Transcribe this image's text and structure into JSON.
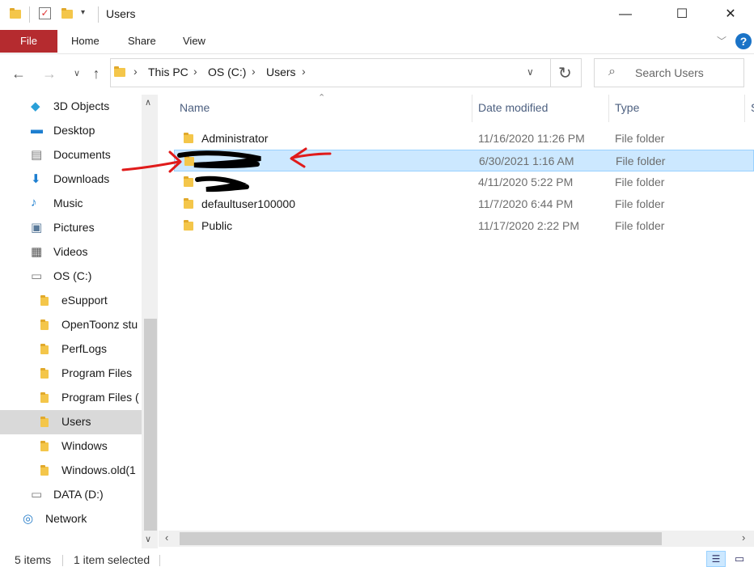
{
  "window": {
    "title": "Users",
    "controls": [
      "—",
      "☐",
      "✕"
    ]
  },
  "ribbon": {
    "file_label": "File",
    "tabs": [
      "Home",
      "Share",
      "View"
    ]
  },
  "address": {
    "crumbs": [
      "This PC",
      "OS (C:)",
      "Users"
    ],
    "search_placeholder": "Search Users"
  },
  "nav": {
    "items": [
      {
        "label": "3D Objects",
        "icon": "3d-objects-icon"
      },
      {
        "label": "Desktop",
        "icon": "desktop-icon"
      },
      {
        "label": "Documents",
        "icon": "documents-icon"
      },
      {
        "label": "Downloads",
        "icon": "downloads-icon"
      },
      {
        "label": "Music",
        "icon": "music-icon"
      },
      {
        "label": "Pictures",
        "icon": "pictures-icon"
      },
      {
        "label": "Videos",
        "icon": "videos-icon"
      },
      {
        "label": "OS (C:)",
        "icon": "drive-icon"
      },
      {
        "label": "eSupport",
        "icon": "folder-icon"
      },
      {
        "label": "OpenToonz stu",
        "icon": "folder-icon"
      },
      {
        "label": "PerfLogs",
        "icon": "folder-icon"
      },
      {
        "label": "Program Files",
        "icon": "folder-icon"
      },
      {
        "label": "Program Files (",
        "icon": "folder-icon"
      },
      {
        "label": "Users",
        "icon": "folder-icon",
        "selected": true
      },
      {
        "label": "Windows",
        "icon": "folder-icon"
      },
      {
        "label": "Windows.old(1",
        "icon": "folder-icon"
      },
      {
        "label": "DATA (D:)",
        "icon": "drive-icon"
      },
      {
        "label": "Network",
        "icon": "network-icon"
      }
    ]
  },
  "list": {
    "columns": [
      "Name",
      "Date modified",
      "Type",
      "S"
    ],
    "rows": [
      {
        "name": "Administrator",
        "date": "11/16/2020 11:26 PM",
        "type": "File folder"
      },
      {
        "name": "",
        "date": "6/30/2021 1:16 AM",
        "type": "File folder",
        "selected": true,
        "redacted": true
      },
      {
        "name": "",
        "date": "4/11/2020 5:22 PM",
        "type": "File folder",
        "redacted": true
      },
      {
        "name": "defaultuser100000",
        "date": "11/7/2020 6:44 PM",
        "type": "File folder"
      },
      {
        "name": "Public",
        "date": "11/17/2020 2:22 PM",
        "type": "File folder"
      }
    ]
  },
  "status": {
    "items_count": "5 items",
    "selected": "1 item selected"
  },
  "colors": {
    "file_tab": "#b52b2f",
    "selected_row": "#cce8ff",
    "annotation_red": "#e01b1b"
  }
}
